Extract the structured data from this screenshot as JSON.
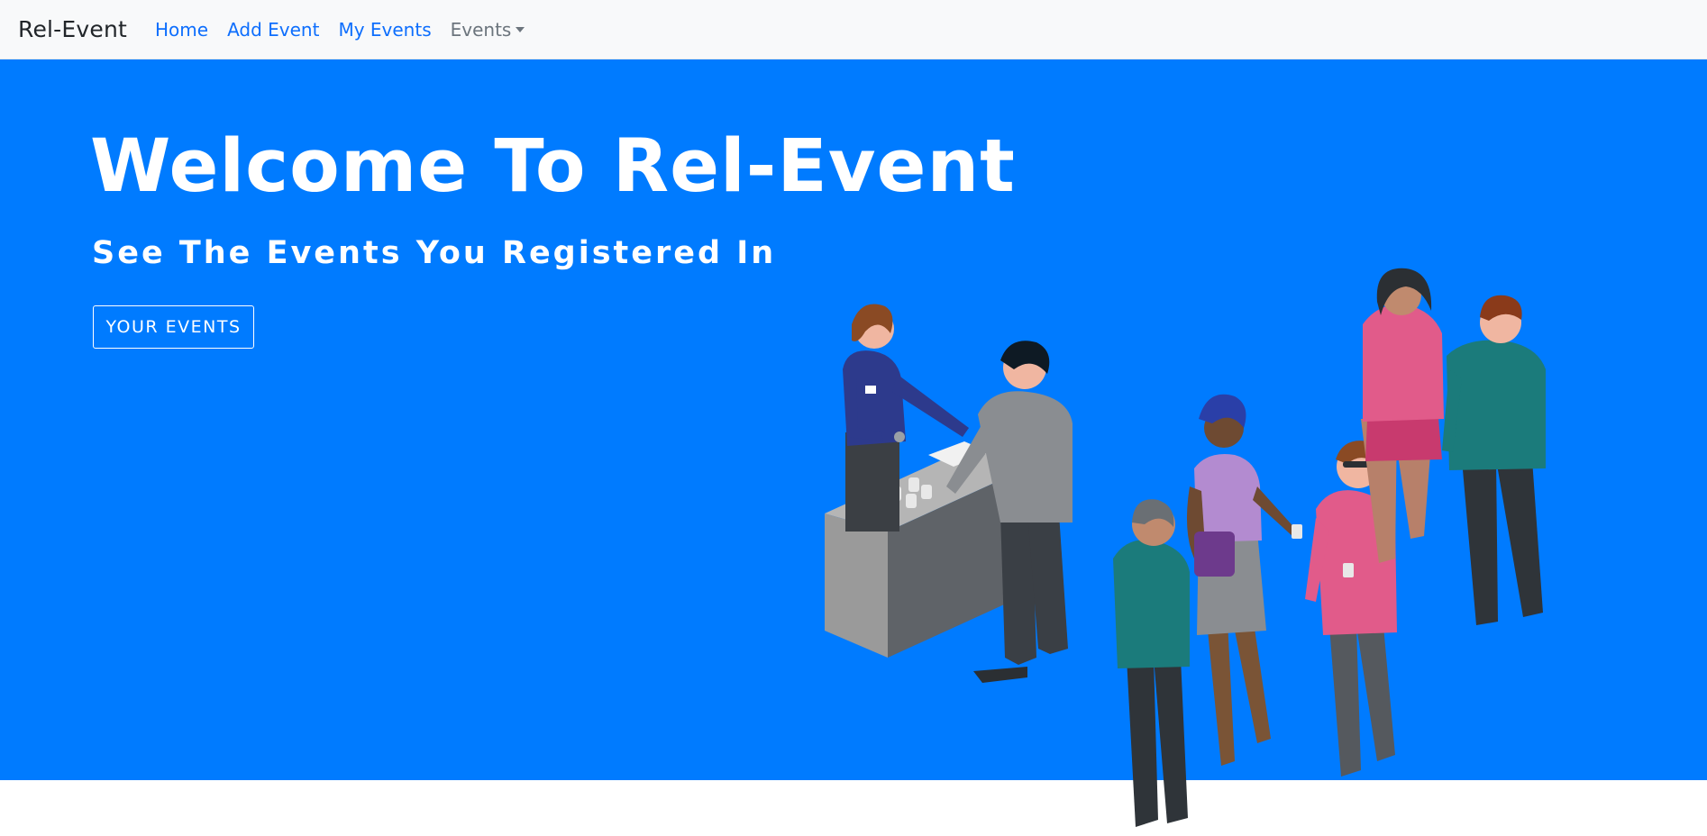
{
  "navbar": {
    "brand": "Rel-Event",
    "links": [
      "Home",
      "Add Event",
      "My Events"
    ],
    "dropdown_label": "Events"
  },
  "hero": {
    "title": "Welcome To Rel-Event",
    "subtitle": "See The Events You Registered In",
    "button_label": "YOUR EVENTS"
  },
  "colors": {
    "hero_background": "#007bff",
    "navbar_background": "#f8f9fa",
    "link": "#0d6efd",
    "muted": "#6c757d"
  },
  "icons": {
    "dropdown": "caret-down-icon"
  }
}
